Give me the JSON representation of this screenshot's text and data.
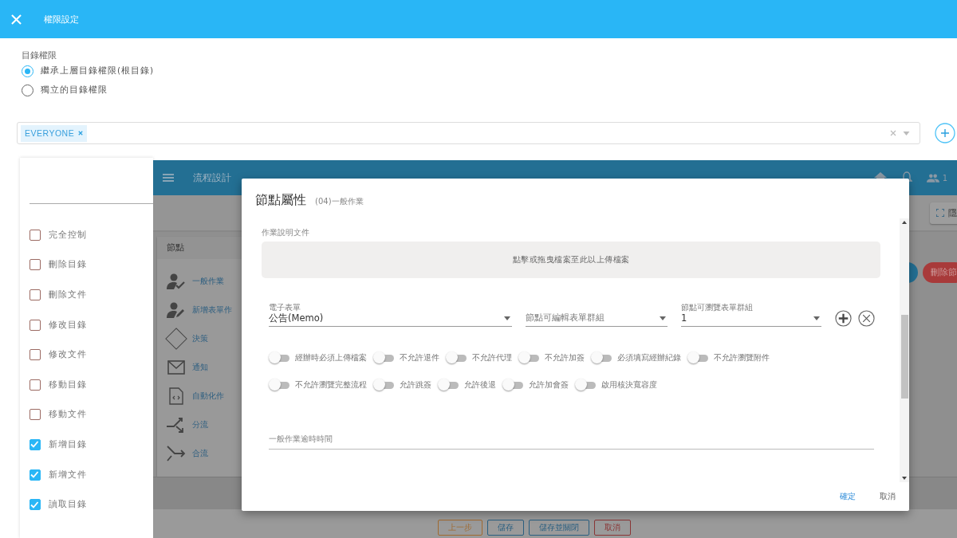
{
  "header": {
    "title": "權限設定"
  },
  "directory_permission": {
    "label": "目錄權限",
    "options": [
      {
        "label": "繼承上層目錄權限(根目錄)",
        "selected": true
      },
      {
        "label": "獨立的目錄權限",
        "selected": false
      }
    ]
  },
  "principals": {
    "tags": [
      "EVERYONE"
    ]
  },
  "permissions": [
    {
      "label": "完全控制",
      "checked": false
    },
    {
      "label": "刪除目錄",
      "checked": false
    },
    {
      "label": "刪除文件",
      "checked": false
    },
    {
      "label": "修改目錄",
      "checked": false
    },
    {
      "label": "修改文件",
      "checked": false
    },
    {
      "label": "移動目錄",
      "checked": false
    },
    {
      "label": "移動文件",
      "checked": false
    },
    {
      "label": "新增目錄",
      "checked": true
    },
    {
      "label": "新增文件",
      "checked": true
    },
    {
      "label": "讀取目錄",
      "checked": true
    }
  ],
  "embedded_app": {
    "title": "流程設計",
    "user_count": "1",
    "toolbar_button": "隱",
    "nodes_title": "節點",
    "action_button": "刪除節",
    "nodes": [
      {
        "label": "一般作業",
        "kind": "person-check"
      },
      {
        "label": "新增表單作",
        "kind": "person-edit"
      },
      {
        "label": "決策",
        "kind": "diamond"
      },
      {
        "label": "通知",
        "kind": "mail"
      },
      {
        "label": "自動化作",
        "kind": "code-file"
      },
      {
        "label": "分流",
        "kind": "split"
      },
      {
        "label": "合流",
        "kind": "merge"
      }
    ],
    "footer_buttons": [
      {
        "label": "上一步",
        "kind": "warning"
      },
      {
        "label": "儲存",
        "kind": "primary"
      },
      {
        "label": "儲存並關閉",
        "kind": "primary"
      },
      {
        "label": "取消",
        "kind": "danger"
      }
    ]
  },
  "dialog": {
    "title": "節點屬性",
    "subtitle": "(04)一般作業",
    "upload_label": "作業說明文件",
    "dropzone": "點擊或拖曳檔案至此以上傳檔案",
    "selects": [
      {
        "label": "電子表單",
        "value": "公告(Memo)"
      },
      {
        "placeholder": "節點可編輯表單群組"
      },
      {
        "label": "節點可瀏覽表單群組",
        "value": "1"
      }
    ],
    "toggles": [
      {
        "label": "經辦時必須上傳檔案",
        "on": false
      },
      {
        "label": "不允許退件",
        "on": false
      },
      {
        "label": "不允許代理",
        "on": false
      },
      {
        "label": "不允許加簽",
        "on": false
      },
      {
        "label": "必須填寫經辦紀錄",
        "on": false
      },
      {
        "label": "不允許瀏覽附件",
        "on": false
      },
      {
        "label": "不允許瀏覽完整流程",
        "on": false
      },
      {
        "label": "允許跳簽",
        "on": false
      },
      {
        "label": "允許後退",
        "on": false
      },
      {
        "label": "允許加會簽",
        "on": false
      },
      {
        "label": "啟用核決寬容度",
        "on": false
      }
    ],
    "timeout_placeholder": "一般作業逾時時間",
    "buttons": [
      {
        "label": "確定",
        "kind": "primary"
      },
      {
        "label": "取消",
        "kind": "plain"
      }
    ]
  }
}
